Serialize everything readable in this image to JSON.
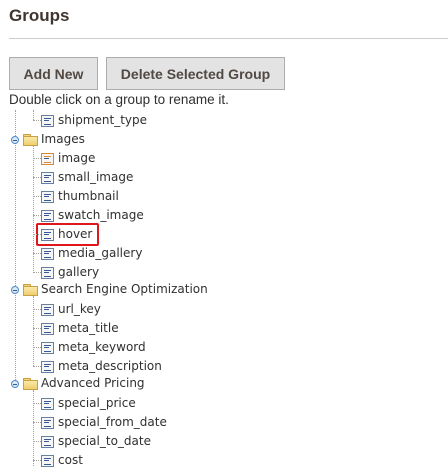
{
  "header": {
    "title": "Groups"
  },
  "toolbar": {
    "add_label": "Add New",
    "delete_label": "Delete Selected Group"
  },
  "hint": "Double click on a group to rename it.",
  "tree": {
    "orphan_items": [
      "shipment_type"
    ],
    "groups": [
      {
        "name": "Images",
        "items": [
          "image",
          "small_image",
          "thumbnail",
          "swatch_image",
          "hover",
          "media_gallery",
          "gallery"
        ]
      },
      {
        "name": "Search Engine Optimization",
        "items": [
          "url_key",
          "meta_title",
          "meta_keyword",
          "meta_description"
        ]
      },
      {
        "name": "Advanced Pricing",
        "items": [
          "special_price",
          "special_from_date",
          "special_to_date",
          "cost"
        ]
      }
    ],
    "highlighted_item": "hover"
  },
  "colors": {
    "highlight": "#e0161b",
    "button_bg": "#e3e3e3",
    "title": "#41362f"
  }
}
